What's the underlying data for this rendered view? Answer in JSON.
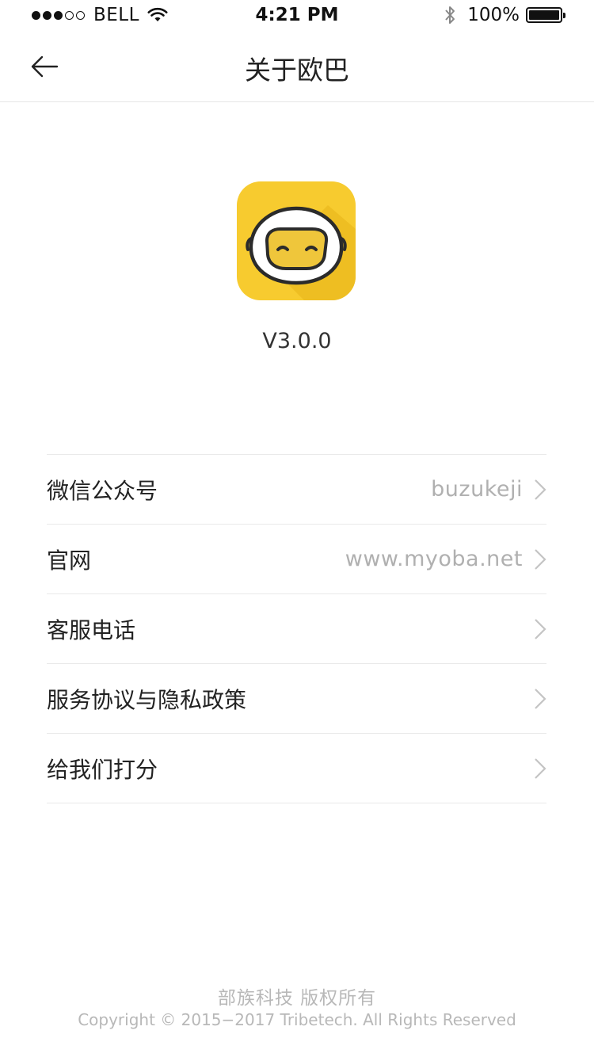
{
  "status_bar": {
    "carrier": "BELL",
    "time": "4:21 PM",
    "battery": "100%",
    "signal_bars_filled": 3,
    "signal_bars_total": 5
  },
  "nav": {
    "title": "关于欧巴",
    "back_icon": "arrow-left-icon"
  },
  "app": {
    "logo_icon": "oba-helmet-logo",
    "version": "V3.0.0",
    "brand_color": "#F5C82E"
  },
  "menu": {
    "items": [
      {
        "label": "微信公众号",
        "value": "buzukeji"
      },
      {
        "label": "官网",
        "value": "www.myoba.net"
      },
      {
        "label": "客服电话",
        "value": ""
      },
      {
        "label": "服务协议与隐私政策",
        "value": ""
      },
      {
        "label": "给我们打分",
        "value": ""
      }
    ],
    "chevron_icon": "chevron-right-icon"
  },
  "footer": {
    "company": "部族科技 版权所有",
    "copyright": "Copyright © 2015−2017 Tribetech. All Rights Reserved"
  }
}
